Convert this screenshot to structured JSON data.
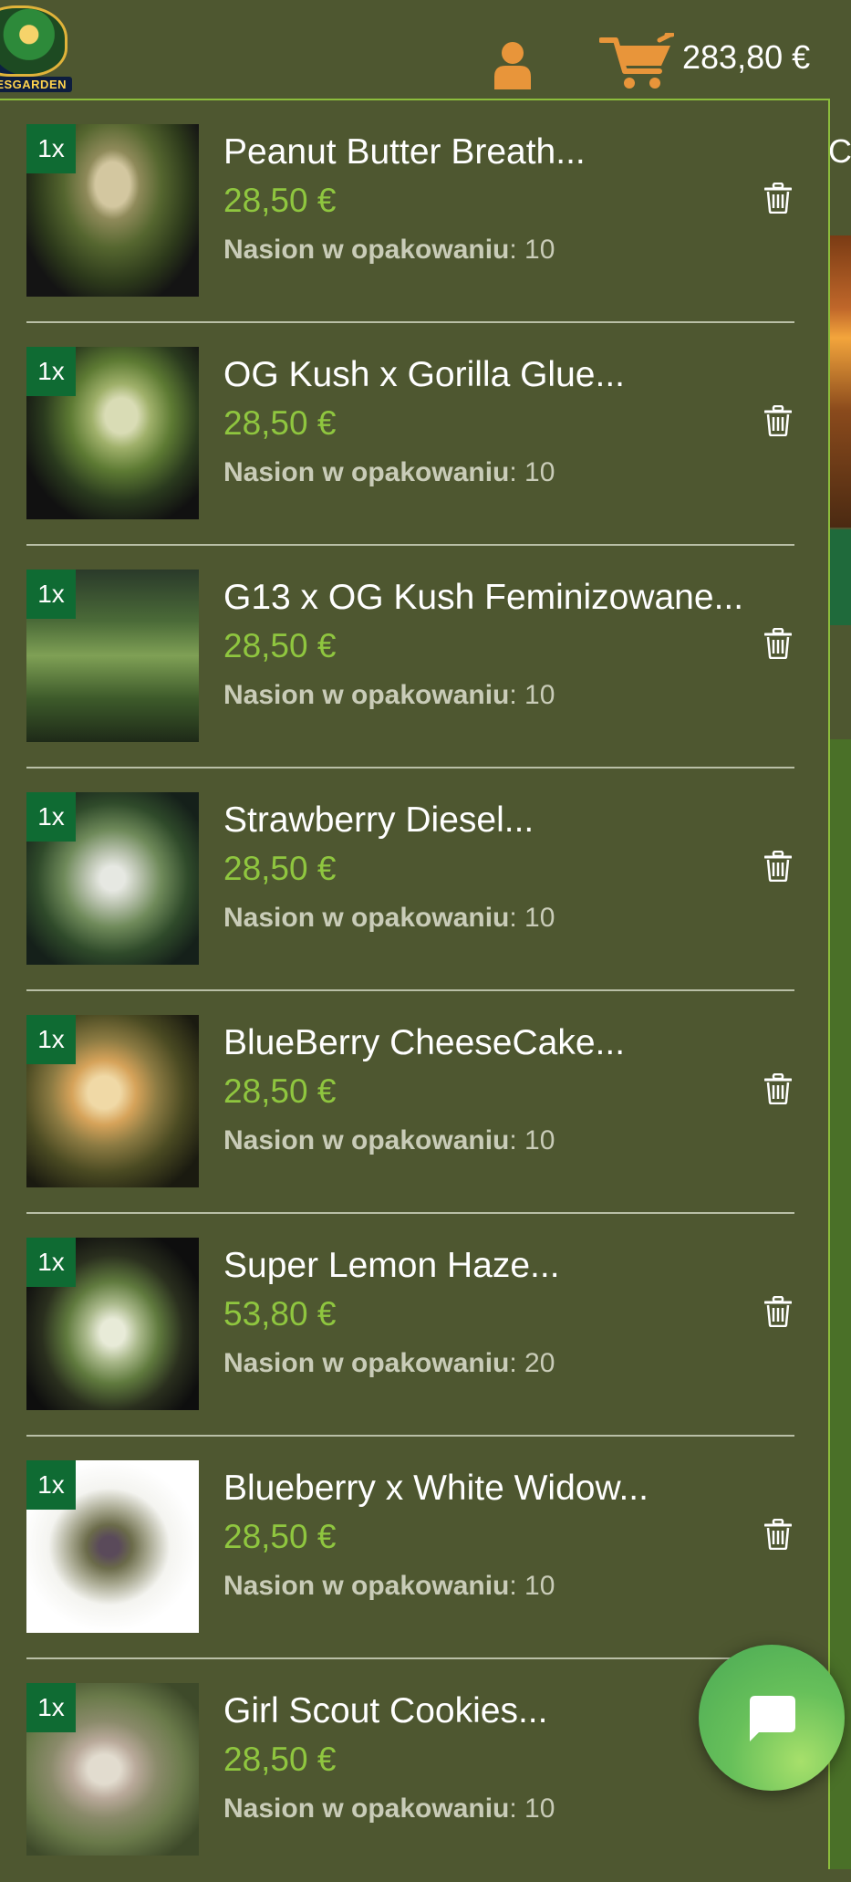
{
  "header": {
    "logo_text": "MESGARDEN",
    "cart_total": "283,80 €"
  },
  "cart": {
    "items": [
      {
        "qty": "1x",
        "title": "Peanut Butter Breath...",
        "price": "28,50 €",
        "seeds_label": "Nasion w opakowaniu",
        "seeds_value": ": 10"
      },
      {
        "qty": "1x",
        "title": "OG Kush x Gorilla Glue...",
        "price": "28,50 €",
        "seeds_label": "Nasion w opakowaniu",
        "seeds_value": ": 10"
      },
      {
        "qty": "1x",
        "title": "G13 x OG Kush Feminizowane...",
        "price": "28,50 €",
        "seeds_label": "Nasion w opakowaniu",
        "seeds_value": ": 10"
      },
      {
        "qty": "1x",
        "title": "Strawberry Diesel...",
        "price": "28,50 €",
        "seeds_label": "Nasion w opakowaniu",
        "seeds_value": ": 10"
      },
      {
        "qty": "1x",
        "title": "BlueBerry CheeseCake...",
        "price": "28,50 €",
        "seeds_label": "Nasion w opakowaniu",
        "seeds_value": ": 10"
      },
      {
        "qty": "1x",
        "title": "Super Lemon Haze...",
        "price": "53,80 €",
        "seeds_label": "Nasion w opakowaniu",
        "seeds_value": ": 20"
      },
      {
        "qty": "1x",
        "title": "Blueberry x White Widow...",
        "price": "28,50 €",
        "seeds_label": "Nasion w opakowaniu",
        "seeds_value": ": 10"
      },
      {
        "qty": "1x",
        "title": "Girl Scout Cookies...",
        "price": "28,50 €",
        "seeds_label": "Nasion w opakowaniu",
        "seeds_value": ": 10"
      }
    ]
  },
  "background_peek_text": "C",
  "colors": {
    "background": "#4e5730",
    "price": "#8fc63f",
    "badge": "#0f6b33",
    "accent_icon": "#e8953a",
    "chat_button": "#67c05a"
  },
  "icons": [
    "user-icon",
    "cart-icon",
    "trash-icon",
    "chat-icon"
  ]
}
